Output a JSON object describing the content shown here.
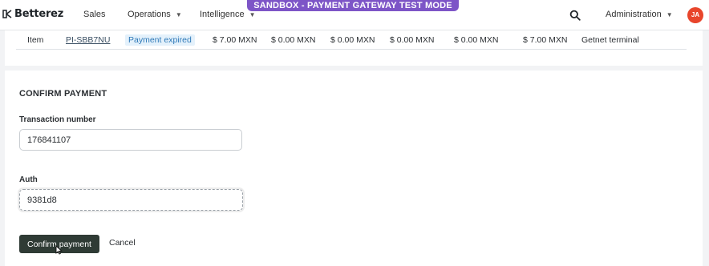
{
  "nav": {
    "logo": "Betterez",
    "items": [
      {
        "label": "Sales",
        "dropdown": false
      },
      {
        "label": "Operations",
        "dropdown": true
      },
      {
        "label": "Intelligence",
        "dropdown": true
      }
    ],
    "banner": "SANDBOX - PAYMENT GATEWAY TEST MODE",
    "search_icon": "search-icon",
    "admin_label": "Administration",
    "avatar_initials": "JA",
    "colors": {
      "banner": "#7d55c7",
      "avatar": "#e8452b"
    }
  },
  "items_table": {
    "rows": [
      {
        "type": "Item",
        "id": "PI-SBB7NU",
        "status": "Payment expired",
        "amounts": [
          "$ 7.00 MXN",
          "$ 0.00 MXN",
          "$ 0.00 MXN",
          "$ 0.00 MXN",
          "$ 0.00 MXN",
          "$ 7.00 MXN"
        ],
        "terminal": "Getnet terminal"
      }
    ]
  },
  "confirm": {
    "title": "CONFIRM PAYMENT",
    "transaction_label": "Transaction number",
    "transaction_value": "176841107",
    "auth_label": "Auth",
    "auth_value": "9381d8",
    "confirm_button": "Confirm payment",
    "cancel_button": "Cancel",
    "colors": {
      "confirm_button": "#2f3b35"
    }
  }
}
